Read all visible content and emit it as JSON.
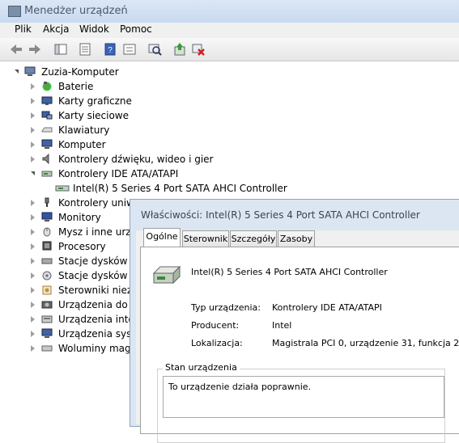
{
  "window": {
    "title": "Menedżer urządzeń"
  },
  "menu": [
    "Plik",
    "Akcja",
    "Widok",
    "Pomoc"
  ],
  "toolbar": [
    "back-icon",
    "forward-icon",
    "show-hide-tree-icon",
    "properties-icon",
    "help-icon",
    "view-icon",
    "scan-hardware-icon",
    "update-driver-icon",
    "uninstall-icon"
  ],
  "tree": {
    "root": "Zuzia-Komputer",
    "items": [
      {
        "label": "Baterie",
        "icon": "battery-icon"
      },
      {
        "label": "Karty graficzne",
        "icon": "display-adapter-icon"
      },
      {
        "label": "Karty sieciowe",
        "icon": "network-adapter-icon"
      },
      {
        "label": "Klawiatury",
        "icon": "keyboard-icon"
      },
      {
        "label": "Komputer",
        "icon": "computer-icon"
      },
      {
        "label": "Kontrolery dźwięku, wideo i gier",
        "icon": "sound-icon"
      },
      {
        "label": "Kontrolery IDE ATA/ATAPI",
        "icon": "ide-controller-icon",
        "expanded": true
      },
      {
        "label": "Intel(R) 5 Series 4 Port SATA AHCI Controller",
        "icon": "ide-device-icon",
        "child": true
      },
      {
        "label": "Kontrolery uniwe",
        "icon": "usb-icon"
      },
      {
        "label": "Monitory",
        "icon": "monitor-icon"
      },
      {
        "label": "Mysz i inne urządz",
        "icon": "mouse-icon"
      },
      {
        "label": "Procesory",
        "icon": "processor-icon"
      },
      {
        "label": "Stacje dysków",
        "icon": "disk-drive-icon"
      },
      {
        "label": "Stacje dysków CD",
        "icon": "cd-drive-icon"
      },
      {
        "label": "Sterowniki niezgo",
        "icon": "driver-icon"
      },
      {
        "label": "Urządzenia do ob",
        "icon": "imaging-icon"
      },
      {
        "label": "Urządzenia interf",
        "icon": "hid-icon"
      },
      {
        "label": "Urządzenia syster",
        "icon": "system-device-icon"
      },
      {
        "label": "Woluminy magaz",
        "icon": "volume-icon"
      }
    ]
  },
  "dialog": {
    "title": "Właściwości: Intel(R) 5 Series 4 Port SATA AHCI Controller",
    "tabs": [
      "Ogólne",
      "Sterownik",
      "Szczegóły",
      "Zasoby"
    ],
    "device_name": "Intel(R) 5 Series 4 Port SATA AHCI Controller",
    "fields": [
      {
        "label": "Typ urządzenia:",
        "value": "Kontrolery IDE ATA/ATAPI"
      },
      {
        "label": "Producent:",
        "value": "Intel"
      },
      {
        "label": "Lokalizacja:",
        "value": "Magistrala PCI 0, urządzenie 31, funkcja 2"
      }
    ],
    "status_group": "Stan urządzenia",
    "status_text": "To urządzenie działa poprawnie."
  }
}
